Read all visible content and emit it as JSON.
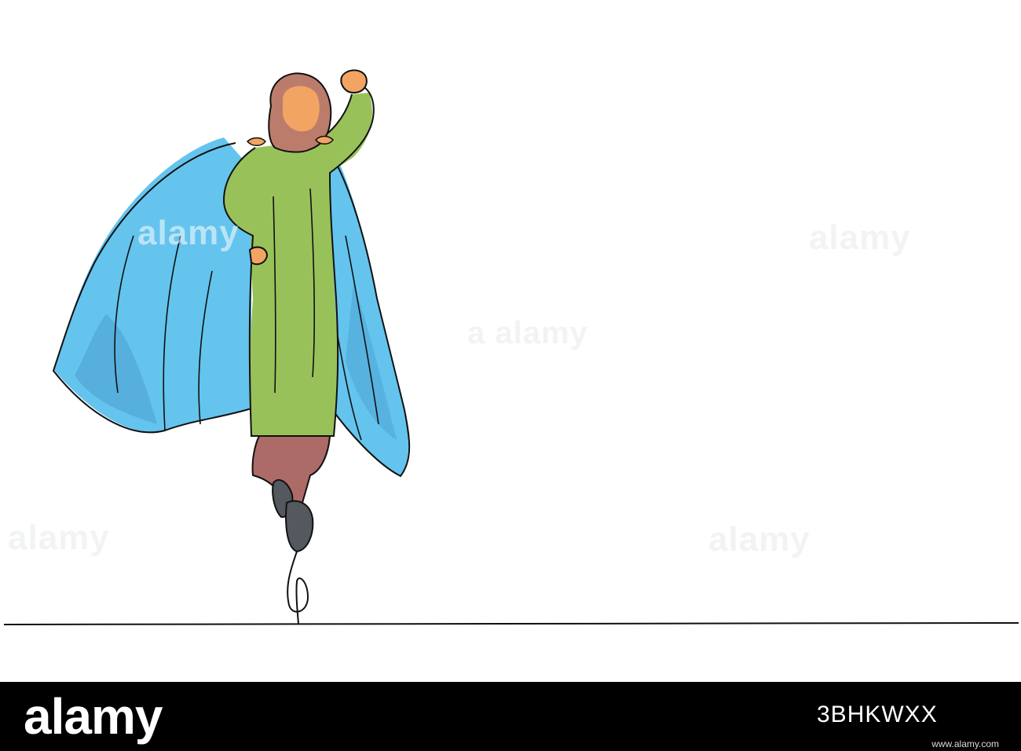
{
  "colors": {
    "cape": "#64c4ee",
    "cape_shadow": "#4a9fd0",
    "dress": "#99c15a",
    "hijab": "#bb7c6c",
    "trousers": "#ac6b67",
    "shoe": "#54585f",
    "skin": "#f2a463",
    "outline": "#111111",
    "footer_bg": "#000000"
  },
  "watermarks": [
    "alamy",
    "alamy",
    "a alamy",
    "alamy",
    "alamy"
  ],
  "footer": {
    "brand": "alamy",
    "stock_id": "3BHKWXX",
    "url": "www.alamy.com"
  }
}
